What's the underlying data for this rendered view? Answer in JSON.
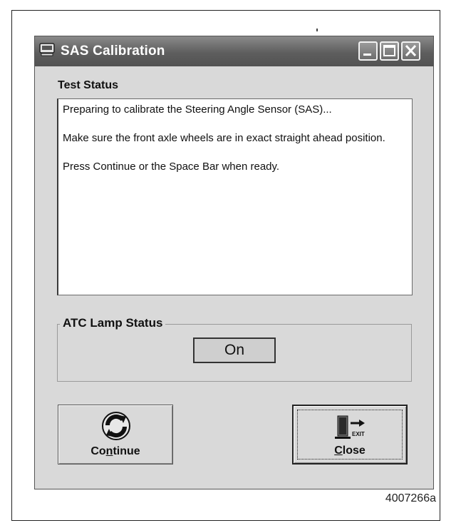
{
  "window": {
    "title": "SAS Calibration",
    "icons": {
      "app": "car-diagnostic-icon",
      "minimize": "minimize-icon",
      "maximize": "maximize-icon",
      "close": "close-icon"
    }
  },
  "test_status": {
    "label": "Test Status",
    "lines": [
      "Preparing to calibrate the Steering Angle Sensor (SAS)...",
      "Make sure the front axle wheels are in exact straight ahead position.",
      "Press Continue or the Space Bar when ready."
    ]
  },
  "atc_lamp": {
    "label": "ATC Lamp Status",
    "value": "On"
  },
  "buttons": {
    "continue": {
      "label_pre": "Co",
      "label_accel": "n",
      "label_post": "tinue",
      "icon": "refresh-icon"
    },
    "close": {
      "label_pre": "",
      "label_accel": "C",
      "label_post": "lose",
      "icon": "exit-icon",
      "icon_text": "EXIT"
    }
  },
  "figure_code": "4007266a"
}
